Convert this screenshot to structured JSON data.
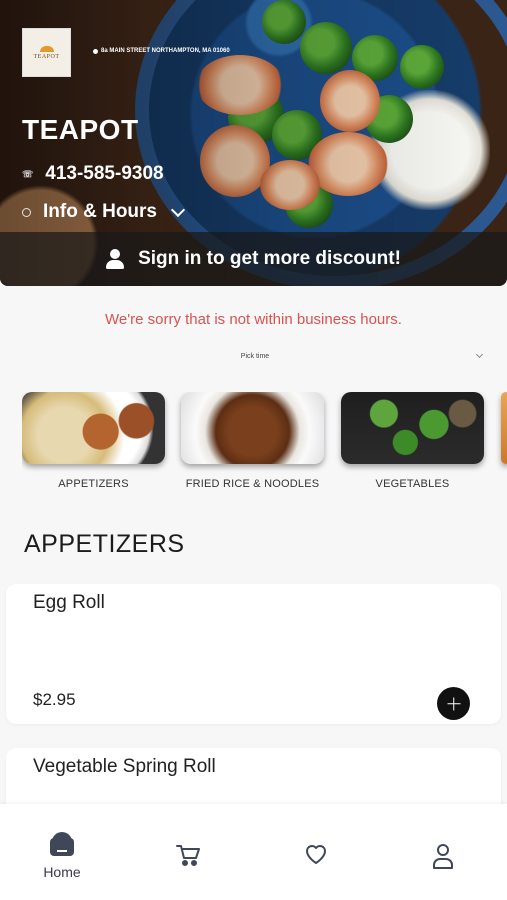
{
  "header": {
    "logo_text": "TEAPOT",
    "address": "8a MAIN STREET NORTHAMPTON, MA 01060",
    "restaurant_name": "TEAPOT",
    "phone": "413-585-9308",
    "info_label": "Info & Hours",
    "signin_text": "Sign in to get more discount!"
  },
  "notice": {
    "message": "We're sorry that is not within business hours.",
    "pick_time": "Pick time"
  },
  "categories": [
    {
      "label": "APPETIZERS"
    },
    {
      "label": "FRIED RICE & NOODLES"
    },
    {
      "label": "VEGETABLES"
    }
  ],
  "section": {
    "title": "APPETIZERS",
    "items": [
      {
        "name": "Egg Roll",
        "price": "$2.95"
      },
      {
        "name": "Vegetable Spring Roll"
      }
    ]
  },
  "nav": {
    "home_label": "Home",
    "icons": [
      "home-icon",
      "cart-icon",
      "heart-icon",
      "user-icon"
    ]
  },
  "colors": {
    "notice_red": "#d9534f",
    "nav_icon": "#3f4759",
    "add_button": "#111111"
  }
}
